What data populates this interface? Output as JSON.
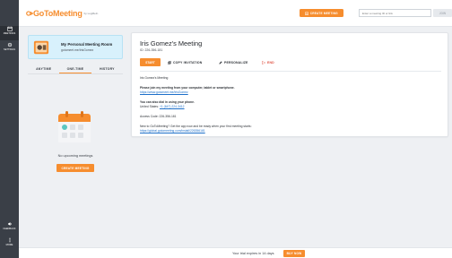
{
  "sidebar": {
    "items": [
      {
        "label": "MEETINGS",
        "icon": "calendar-icon"
      },
      {
        "label": "SETTINGS",
        "icon": "gear-icon"
      },
      {
        "label": "FEEDBACK",
        "icon": "megaphone-icon"
      },
      {
        "label": "MORE",
        "icon": "more-vertical-icon"
      }
    ]
  },
  "header": {
    "logo_text": "GoToMeeting",
    "logo_by": "by LogMeIn",
    "create_label": "CREATE MEETING",
    "join_placeholder": "Enter a meeting ID or link",
    "join_label": "JOIN"
  },
  "room": {
    "title": "My Personal Meeting Room",
    "link": "gotomeet.me/IrisGomez"
  },
  "tabs": [
    {
      "label": "ANYTIME",
      "active": false
    },
    {
      "label": "ONE-TIME",
      "active": true
    },
    {
      "label": "HISTORY",
      "active": false
    }
  ],
  "empty_state": {
    "text": "No upcoming meetings",
    "create_label": "CREATE MEETING"
  },
  "meeting": {
    "title": "Iris Gomez's Meeting",
    "id_line": "ID: 226-356-181",
    "start_label": "START",
    "copy_label": "COPY INVITATION",
    "personalize_label": "PERSONALIZE",
    "end_label": "END",
    "body": {
      "heading": "Iris Gomez's Meeting",
      "join_prompt": "Please join my meeting from your computer, tablet or smartphone.",
      "join_link": "https://www.gotomeet.me/IrisGomez",
      "dial_prompt": "You can also dial in using your phone.",
      "dial_prefix": "United States: ",
      "dial_number": "+1 (647) 224-3412",
      "access_code": "Access Code: 226-356-181",
      "new_user_text": "New to GoToMeeting? Get the app now and be ready when your first meeting starts:",
      "install_link": "https://global.gotomeeting.com/install/226356181"
    }
  },
  "footer": {
    "trial_text": "Your trial expires in 14 days",
    "buy_label": "BUY NOW"
  },
  "colors": {
    "accent": "#f68d2e",
    "sidebar": "#3a3f47",
    "room_card": "#d8f1fc",
    "link": "#1c6fc9",
    "end": "#e05243"
  }
}
